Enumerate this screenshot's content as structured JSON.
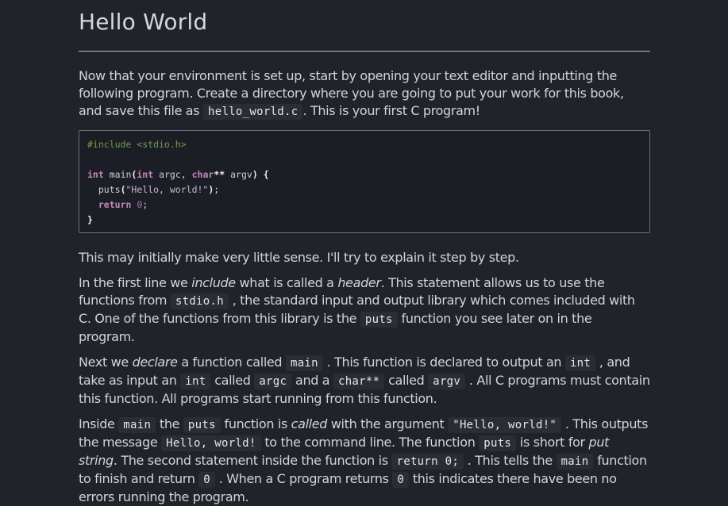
{
  "title": "Hello World",
  "para1": {
    "t1": "Now that your environment is set up, start by opening your text editor and inputting the following program. Create a directory where you are going to put your work for this book, and save this file as ",
    "c1": "hello_world.c",
    "t2": ". This is your first C program!"
  },
  "code": {
    "line1": "#include <stdio.h>",
    "kw_int": "int",
    "fn_main": "main",
    "paren_open": "(",
    "kw_int2": "int",
    "argc": "argc, ",
    "kw_char": "char",
    "stars": "**",
    "argv": " argv",
    "paren_close": ")",
    "brace_open": "{",
    "puts": "puts",
    "puts_paren_open": "(",
    "str": "\"Hello, world!\"",
    "puts_paren_close": ")",
    "semi1": ";",
    "kw_return": "return",
    "num0": "0",
    "semi2": ";",
    "brace_close": "}"
  },
  "para2": "This may initially make very little sense. I'll try to explain it step by step.",
  "para3": {
    "t1": "In the first line we ",
    "e1": "include",
    "t2": " what is called a ",
    "e2": "header",
    "t3": ". This statement allows us to use the functions from ",
    "c1": "stdio.h",
    "t4": " , the standard input and output library which comes included with C. One of the functions from this library is the ",
    "c2": "puts",
    "t5": " function you see later on in the program."
  },
  "para4": {
    "t1": "Next we ",
    "e1": "declare",
    "t2": " a function called ",
    "c1": "main",
    "t3": " . This function is declared to output an ",
    "c2": "int",
    "t4": " , and take as input an ",
    "c3": "int",
    "t5": " called ",
    "c4": "argc",
    "t6": " and a ",
    "c5": "char**",
    "t7": " called ",
    "c6": "argv",
    "t8": " . All C programs must contain this function. All programs start running from this function."
  },
  "para5": {
    "t1": "Inside ",
    "c1": "main",
    "t2": " the ",
    "c2": "puts",
    "t3": " function is ",
    "e1": "called",
    "t4": " with the argument ",
    "c3": "\"Hello, world!\"",
    "t5": " . This outputs the message ",
    "c4": "Hello, world!",
    "t6": " to the command line. The function ",
    "c5": "puts",
    "t7": " is short for ",
    "e2": "put string",
    "t8": ". The second statement inside the function is ",
    "c6": "return 0;",
    "t9": " . This tells the ",
    "c7": "main",
    "t10": " function to finish and return ",
    "c8": "0",
    "t11": " . When a C program returns ",
    "c9": "0",
    "t12": " this indicates there have been no errors running the program."
  }
}
